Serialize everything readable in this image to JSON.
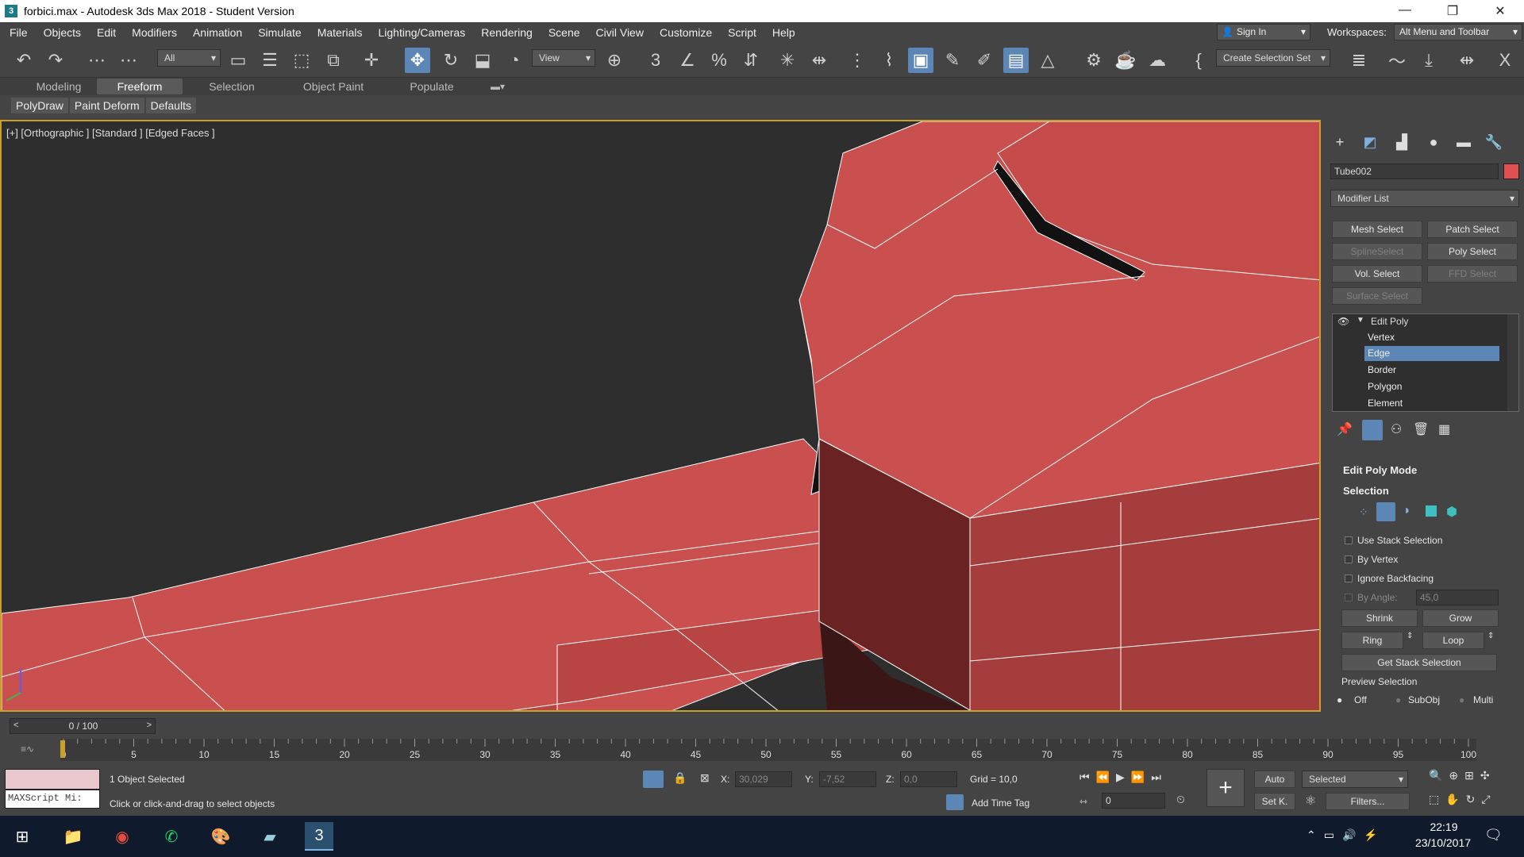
{
  "window": {
    "title": "forbici.max - Autodesk 3ds Max 2018 - Student Version",
    "minimize": "—",
    "maximize": "❐",
    "close": "✕"
  },
  "menu": {
    "items": [
      "File",
      "Objects",
      "Edit",
      "Modifiers",
      "Animation",
      "Simulate",
      "Materials",
      "Lighting/Cameras",
      "Rendering",
      "Scene",
      "Civil View",
      "Customize",
      "Script",
      "Help"
    ],
    "sign_in": "Sign In",
    "workspaces_label": "Workspaces:",
    "workspace_value": "Alt Menu and Toolbar"
  },
  "toolbar": {
    "filter_value": "All",
    "ref_coord_value": "View",
    "selection_set_value": "Create Selection Set"
  },
  "ribbon": {
    "tabs": [
      "Modeling",
      "Freeform",
      "Selection",
      "Object Paint",
      "Populate"
    ],
    "active_tab": "Freeform",
    "subtabs": [
      "PolyDraw",
      "Paint Deform",
      "Defaults"
    ]
  },
  "viewport": {
    "label": "[+] [Orthographic ] [Standard ] [Edged Faces ]",
    "object_color": "#c84d4d"
  },
  "command_panel": {
    "object_name": "Tube002",
    "object_color": "#e05050",
    "modifier_list": "Modifier List",
    "buttons": {
      "mesh_select": "Mesh Select",
      "patch_select": "Patch Select",
      "spline_select": "SplineSelect",
      "poly_select": "Poly Select",
      "vol_select": "Vol. Select",
      "ffd_select": "FFD Select",
      "surface_select": "Surface Select"
    },
    "stack": {
      "modifier": "Edit Poly",
      "subobjects": [
        "Vertex",
        "Edge",
        "Border",
        "Polygon",
        "Element"
      ],
      "selected": "Edge"
    },
    "rollouts": {
      "edit_poly_mode": "Edit Poly Mode",
      "selection": "Selection"
    },
    "selection": {
      "use_stack_selection": "Use Stack Selection",
      "by_vertex": "By Vertex",
      "ignore_backfacing": "Ignore Backfacing",
      "by_angle_label": "By Angle:",
      "by_angle_value": "45,0",
      "shrink": "Shrink",
      "grow": "Grow",
      "ring": "Ring",
      "loop": "Loop",
      "get_stack_selection": "Get Stack Selection",
      "preview_selection": "Preview Selection",
      "preview_off": "Off",
      "preview_subobj": "SubObj",
      "preview_multi": "Multi"
    }
  },
  "timeline": {
    "frame_display": "0 / 100",
    "ticks": [
      "0",
      "5",
      "10",
      "15",
      "20",
      "25",
      "30",
      "35",
      "40",
      "45",
      "50",
      "55",
      "60",
      "65",
      "70",
      "75",
      "80",
      "85",
      "90",
      "95",
      "100"
    ]
  },
  "status": {
    "maxscript": "MAXScript Mi:",
    "objects_selected": "1 Object Selected",
    "prompt": "Click or click-and-drag to select objects",
    "x_label": "X:",
    "x_value": "30,029",
    "y_label": "Y:",
    "y_value": "-7,52",
    "z_label": "Z:",
    "z_value": "0,0",
    "grid": "Grid = 10,0",
    "add_time_tag": "Add Time Tag",
    "auto": "Auto",
    "set_key": "Set K.",
    "key_filter_value": "Selected",
    "filters": "Filters...",
    "frame_value": "0"
  },
  "taskbar": {
    "time": "22:19",
    "date": "23/10/2017"
  }
}
